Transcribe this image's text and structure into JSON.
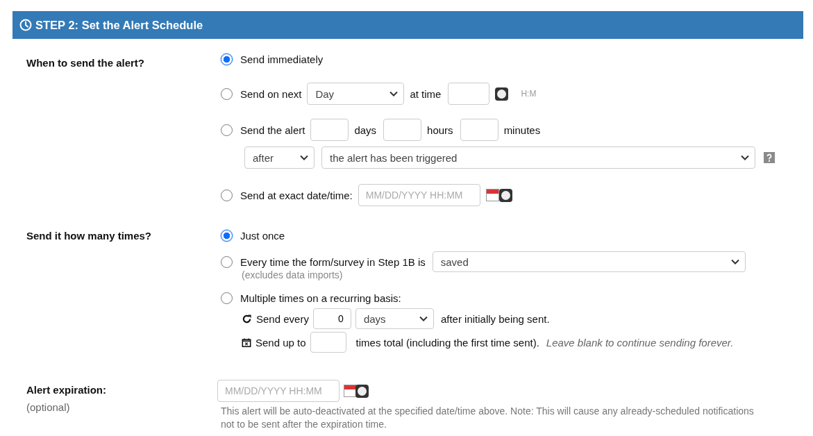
{
  "header": {
    "title": "STEP 2: Set the Alert Schedule"
  },
  "when": {
    "label": "When to send the alert?",
    "options": [
      {
        "kind": "plain",
        "label": "Send immediately",
        "selected": true
      },
      {
        "kind": "next",
        "label": "Send on next",
        "select": "Day",
        "after_label": "at time",
        "hint": "H:M",
        "selected": false
      },
      {
        "kind": "delay",
        "label": "Send the alert",
        "units": [
          "days",
          "hours",
          "minutes"
        ],
        "direction": "after",
        "event": "the alert has been triggered",
        "selected": false
      },
      {
        "kind": "exact",
        "label": "Send at exact date/time:",
        "placeholder": "MM/DD/YYYY HH:MM",
        "selected": false
      }
    ]
  },
  "times": {
    "label": "Send it how many times?",
    "options": [
      {
        "kind": "plain",
        "label": "Just once",
        "selected": true
      },
      {
        "kind": "every",
        "label": "Every time the form/survey in Step 1B is",
        "select": "saved",
        "note": "(excludes data imports)",
        "selected": false
      },
      {
        "kind": "recurring",
        "label": "Multiple times on a recurring basis:",
        "every_label": "Send every",
        "every_value": "0",
        "every_unit": "days",
        "every_suffix": "after initially being sent.",
        "upto_label": "Send up to",
        "upto_suffix": "times total (including the first time sent).",
        "upto_hint": "Leave blank to continue sending forever.",
        "selected": false
      }
    ]
  },
  "expiration": {
    "label": "Alert expiration:",
    "sublabel": "(optional)",
    "placeholder": "MM/DD/YYYY HH:MM",
    "note": "This alert will be auto-deactivated at the specified date/time above. Note: This will cause any already-scheduled notifications not to be sent after the expiration time."
  }
}
